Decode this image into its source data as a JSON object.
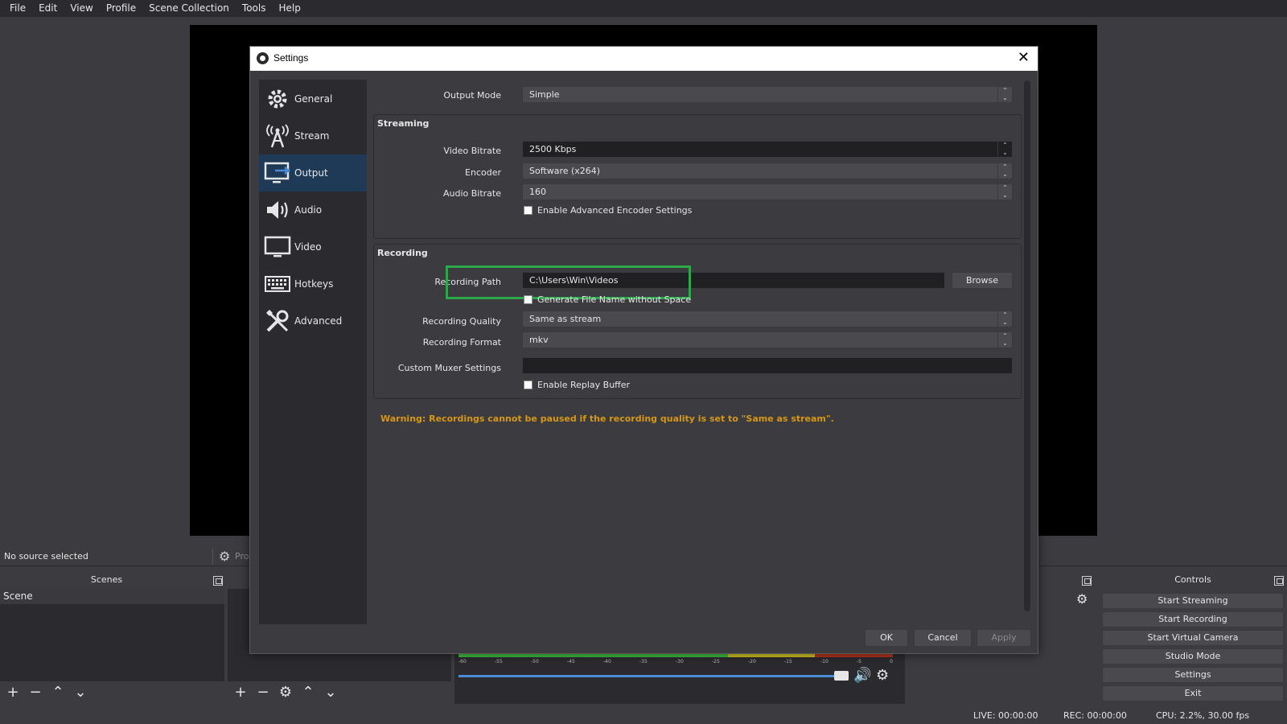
{
  "menu": [
    "File",
    "Edit",
    "View",
    "Profile",
    "Scene Collection",
    "Tools",
    "Help"
  ],
  "source_bar": {
    "no_source": "No source selected",
    "properties": "Pro"
  },
  "scenes": {
    "title": "Scenes",
    "items": [
      "Scene"
    ]
  },
  "controls": {
    "title": "Controls",
    "buttons": [
      "Start Streaming",
      "Start Recording",
      "Start Virtual Camera",
      "Studio Mode",
      "Settings",
      "Exit"
    ]
  },
  "mixer": {
    "scale": [
      "-60",
      "-55",
      "-50",
      "-45",
      "-40",
      "-35",
      "-30",
      "-25",
      "-20",
      "-15",
      "-10",
      "-5",
      "0"
    ]
  },
  "status": {
    "live": "LIVE: 00:00:00",
    "rec": "REC: 00:00:00",
    "cpu": "CPU: 2.2%, 30.00 fps"
  },
  "settings": {
    "title": "Settings",
    "sidebar": [
      "General",
      "Stream",
      "Output",
      "Audio",
      "Video",
      "Hotkeys",
      "Advanced"
    ],
    "active_section": "Output",
    "output_mode": {
      "label": "Output Mode",
      "value": "Simple"
    },
    "streaming": {
      "title": "Streaming",
      "video_bitrate": {
        "label": "Video Bitrate",
        "value": "2500 Kbps"
      },
      "encoder": {
        "label": "Encoder",
        "value": "Software (x264)"
      },
      "audio_bitrate": {
        "label": "Audio Bitrate",
        "value": "160"
      },
      "advanced_encoder": "Enable Advanced Encoder Settings"
    },
    "recording": {
      "title": "Recording",
      "path": {
        "label": "Recording Path",
        "value": "C:\\Users\\Win\\Videos"
      },
      "browse": "Browse",
      "no_space": "Generate File Name without Space",
      "quality": {
        "label": "Recording Quality",
        "value": "Same as stream"
      },
      "format": {
        "label": "Recording Format",
        "value": "mkv"
      },
      "muxer": {
        "label": "Custom Muxer Settings",
        "value": ""
      },
      "replay": "Enable Replay Buffer"
    },
    "warning": "Warning: Recordings cannot be paused if the recording quality is set to \"Same as stream\".",
    "buttons": {
      "ok": "OK",
      "cancel": "Cancel",
      "apply": "Apply"
    },
    "colors": {
      "highlight": "#2ca84a",
      "warning": "#d59717",
      "active": "#1f3a57"
    }
  }
}
